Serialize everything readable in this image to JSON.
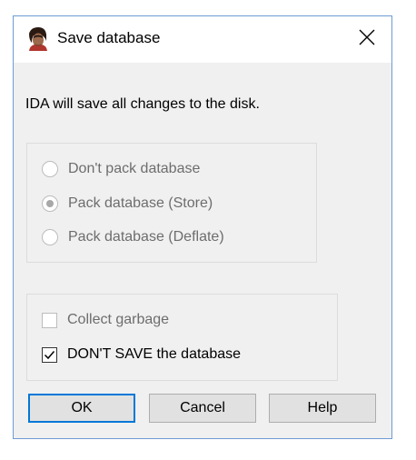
{
  "window": {
    "title": "Save database",
    "close_symbol": "✕"
  },
  "message": "IDA will save all changes to the disk.",
  "pack_options": [
    {
      "label": "Don't pack database",
      "checked": false
    },
    {
      "label": "Pack database (Store)",
      "checked": true
    },
    {
      "label": "Pack database (Deflate)",
      "checked": false
    }
  ],
  "options": {
    "collect_garbage": {
      "label": "Collect garbage",
      "checked": false,
      "enabled": false
    },
    "dont_save": {
      "label": "DON'T SAVE the database",
      "checked": true,
      "enabled": true
    }
  },
  "buttons": {
    "ok": "OK",
    "cancel": "Cancel",
    "help": "Help"
  },
  "icons": {
    "app": "ida-app-icon",
    "close": "close-icon"
  },
  "colors": {
    "accent": "#0078d7",
    "window_border": "#6d9cd4"
  }
}
